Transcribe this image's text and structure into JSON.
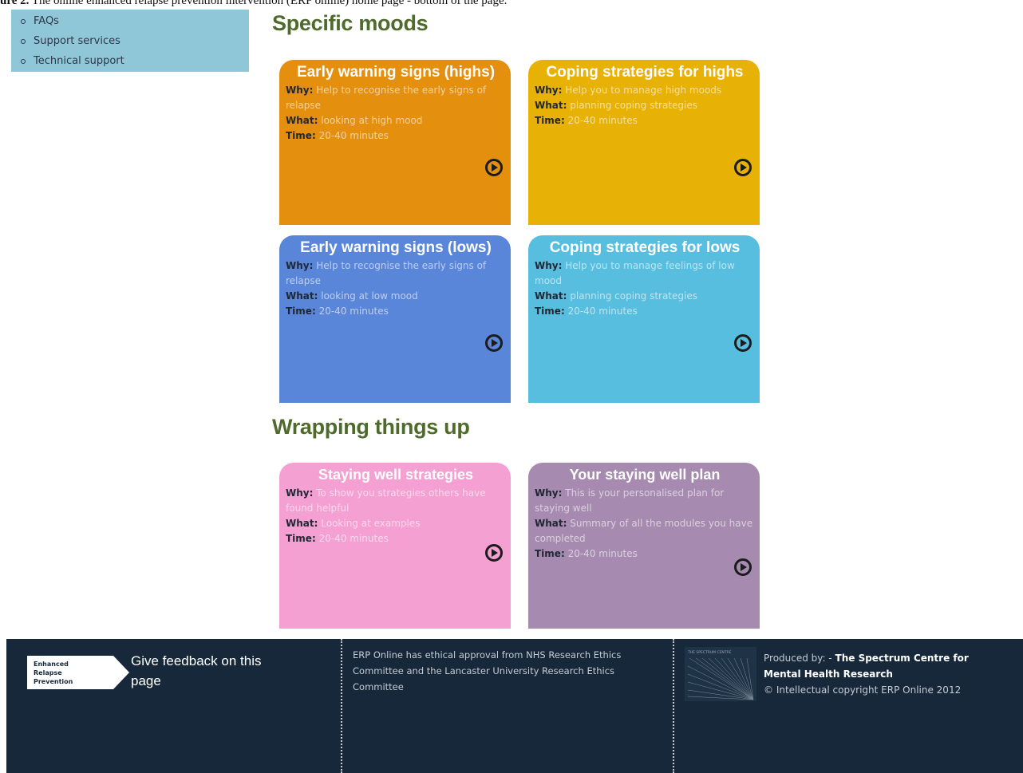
{
  "caption": {
    "label": "ure 2.",
    "text": " The online enhanced relapse prevention intervention (ERP online) home page - bottom of the page."
  },
  "sidebar": {
    "items": [
      "FAQs",
      "Support services",
      "Technical support"
    ]
  },
  "sections": [
    {
      "title": "Specific moods",
      "cards": [
        {
          "title": "Early warning signs (highs)",
          "why_label": "Why:",
          "why": "Help to recognise the early signs of relapse",
          "what_label": "What:",
          "what": "looking at high mood",
          "time_label": "Time:",
          "time": "20-40 minutes",
          "color": "#e58f0e"
        },
        {
          "title": "Coping strategies for highs",
          "why_label": "Why:",
          "why": "Help you to manage high moods",
          "what_label": "What:",
          "what": "planning coping strategies",
          "time_label": "Time:",
          "time": "20-40 minutes",
          "color": "#e7b105"
        },
        {
          "title": "Early warning signs (lows)",
          "why_label": "Why:",
          "why": "Help to recognise the early signs of relapse",
          "what_label": "What:",
          "what": "looking at low mood",
          "time_label": "Time:",
          "time": "20-40 minutes",
          "color": "#5a86da"
        },
        {
          "title": "Coping strategies for lows",
          "why_label": "Why:",
          "why": "Help you to manage feelings of low mood",
          "what_label": "What:",
          "what": "planning coping strategies",
          "time_label": "Time:",
          "time": "20-40 minutes",
          "color": "#58bedf"
        }
      ]
    },
    {
      "title": "Wrapping things up",
      "cards": [
        {
          "title": "Staying well strategies",
          "why_label": "Why:",
          "why": "To show you strategies others have found helpful",
          "what_label": "What:",
          "what": "Looking at examples",
          "time_label": "Time:",
          "time": "20-40 minutes",
          "color": "#f5a0d3"
        },
        {
          "title": "Your staying well plan",
          "why_label": "Why:",
          "why": "This is your personalised plan for staying well",
          "what_label": "What:",
          "what": "Summary of all the modules you have completed",
          "time_label": "Time:",
          "time": "20-40 minutes",
          "color": "#a68ab0"
        }
      ]
    }
  ],
  "icons": {
    "play": "play-circle-icon"
  },
  "footer": {
    "logo_lines": [
      "Enhanced",
      "Relapse",
      "Prevention"
    ],
    "feedback": "Give feedback on this page",
    "ethics": "ERP Online has ethical approval from NHS Research Ethics Committee and the Lancaster University Research Ethics Committee",
    "spectrum_logo_text": "THE SPECTRUM CENTRE",
    "produced_prefix": "Produced by: - ",
    "produced_org": "The Spectrum Centre for Mental Health Research",
    "copyright": "© Intellectual copyright ERP Online 2012",
    "background_color": "#16283a"
  }
}
